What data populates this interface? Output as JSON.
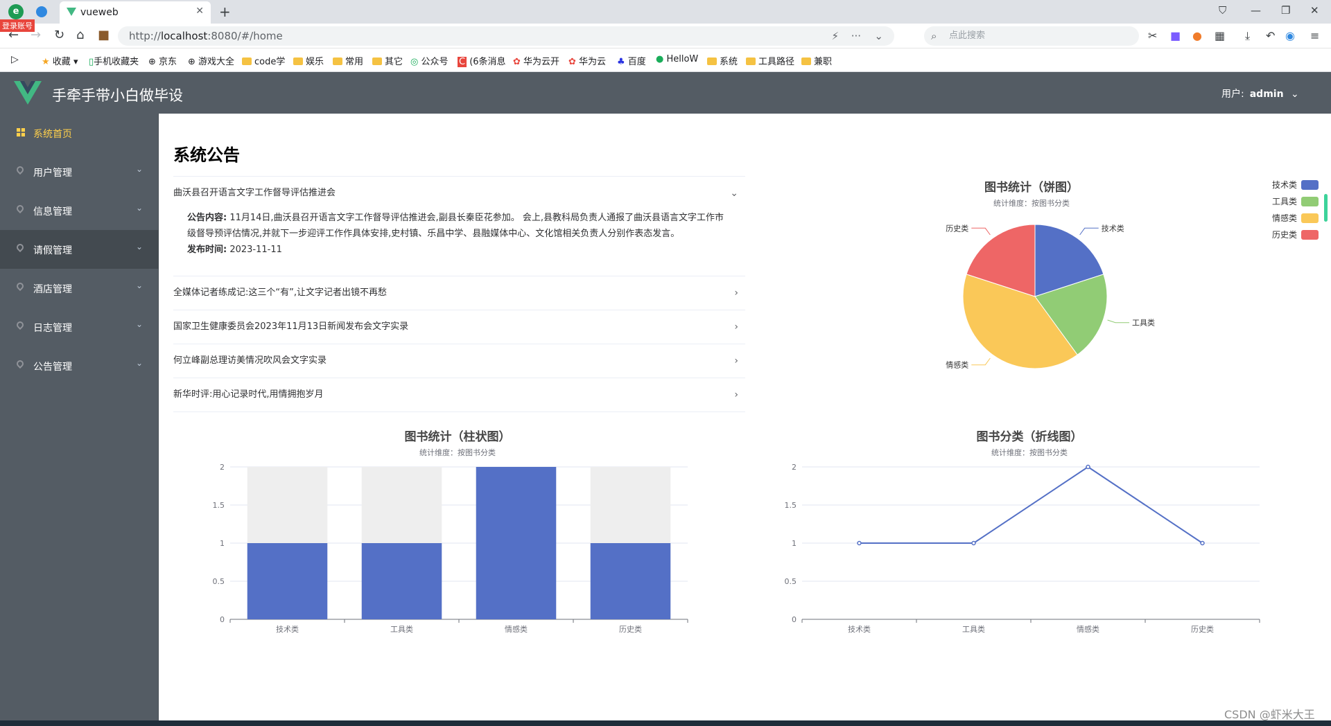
{
  "browser": {
    "tab_title": "vueweb",
    "login_badge": "登录账号",
    "url_prefix": "http://",
    "url_host": "localhost",
    "url_rest": ":8080/#/home",
    "search_placeholder": "点此搜索",
    "bookmarks": [
      "收藏",
      "手机收藏夹",
      "京东",
      "游戏大全",
      "code学",
      "娱乐",
      "常用",
      "其它",
      "公众号",
      "(6条消息",
      "华为云开",
      "华为云",
      "百度",
      "HelloW",
      "系统",
      "工具路径",
      "兼职"
    ]
  },
  "app": {
    "title": "手牵手带小白做毕设",
    "user_label": "用户:",
    "user_name": "admin"
  },
  "sidebar": {
    "items": [
      {
        "label": "系统首页"
      },
      {
        "label": "用户管理"
      },
      {
        "label": "信息管理"
      },
      {
        "label": "请假管理"
      },
      {
        "label": "酒店管理"
      },
      {
        "label": "日志管理"
      },
      {
        "label": "公告管理"
      }
    ]
  },
  "notice": {
    "heading": "系统公告",
    "items": [
      {
        "title": "曲沃县召开语言文字工作督导评估推进会",
        "content_label": "公告内容:",
        "content": "11月14日,曲沃县召开语言文字工作督导评估推进会,副县长秦臣花参加。 会上,县教科局负责人通报了曲沃县语言文字工作市级督导预评估情况,并就下一步迎评工作作具体安排,史村镇、乐昌中学、县融媒体中心、文化馆相关负责人分别作表态发言。",
        "date_label": "发布时间:",
        "date": "2023-11-11"
      },
      {
        "title": "全媒体记者练成记:这三个“有”,让文字记者出镜不再愁"
      },
      {
        "title": "国家卫生健康委员会2023年11月13日新闻发布会文字实录"
      },
      {
        "title": "何立峰副总理访美情况吹风会文字实录"
      },
      {
        "title": "新华时评:用心记录时代,用情拥抱岁月"
      }
    ]
  },
  "colors": {
    "blue": "#5470c6",
    "green": "#91cc75",
    "yellow": "#fac858",
    "red": "#ee6666"
  },
  "chart_data": [
    {
      "type": "pie",
      "title": "图书统计（饼图）",
      "subtitle": "统计维度：按图书分类",
      "categories": [
        "技术类",
        "工具类",
        "情感类",
        "历史类"
      ],
      "values": [
        1,
        1,
        2,
        1
      ],
      "legend_position": "top-right"
    },
    {
      "type": "bar",
      "title": "图书统计（柱状图）",
      "subtitle": "统计维度：按图书分类",
      "categories": [
        "技术类",
        "工具类",
        "情感类",
        "历史类"
      ],
      "values": [
        1,
        1,
        2,
        1
      ],
      "ylim": [
        0,
        2
      ],
      "yticks": [
        "0",
        "0.5",
        "1",
        "1.5",
        "2"
      ],
      "show_background": true
    },
    {
      "type": "line",
      "title": "图书分类（折线图）",
      "subtitle": "统计维度：按图书分类",
      "categories": [
        "技术类",
        "工具类",
        "情感类",
        "历史类"
      ],
      "values": [
        1,
        1,
        2,
        1
      ],
      "ylim": [
        0,
        2
      ],
      "yticks": [
        "0",
        "0.5",
        "1",
        "1.5",
        "2"
      ]
    }
  ],
  "watermark": "CSDN @虾米大王"
}
